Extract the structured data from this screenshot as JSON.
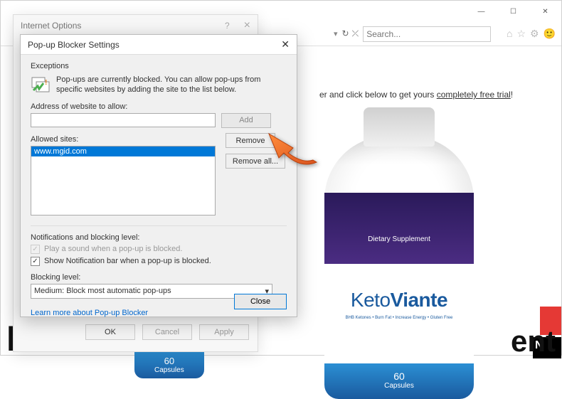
{
  "browser": {
    "search_placeholder": "Search...",
    "url_sep": "▾",
    "refresh": "↻",
    "stop": "⤫"
  },
  "page": {
    "promo_prefix": "er and click below to get yours ",
    "promo_link": "completely free trial",
    "promo_suffix": "!",
    "dietary": "Dietary Supplement",
    "keto": "Keto",
    "viante": "Viante",
    "keto_sub": "BHB Ketones • Burn Fat • Increase Energy • Gluten Free",
    "caps_num": "60",
    "caps_label": "Capsules",
    "black_strip": "N",
    "big_left": "HIS",
    "big_right": "ent"
  },
  "internet_options": {
    "title": "Internet Options",
    "help": "?",
    "close": "×",
    "ok": "OK",
    "cancel": "Cancel",
    "apply": "Apply"
  },
  "popup_blocker": {
    "title": "Pop-up Blocker Settings",
    "close_x": "✕",
    "exceptions_label": "Exceptions",
    "description": "Pop-ups are currently blocked. You can allow pop-ups from specific websites by adding the site to the list below.",
    "address_label": "Address of website to allow:",
    "address_value": "",
    "add_btn": "Add",
    "allowed_label": "Allowed sites:",
    "allowed_sites": [
      "www.mgid.com"
    ],
    "remove_btn": "Remove",
    "remove_all_btn": "Remove all...",
    "notif_heading": "Notifications and blocking level:",
    "play_sound": "Play a sound when a pop-up is blocked.",
    "show_bar": "Show Notification bar when a pop-up is blocked.",
    "blocking_level_label": "Blocking level:",
    "blocking_level_value": "Medium: Block most automatic pop-ups",
    "learn_more": "Learn more about Pop-up Blocker",
    "close_btn": "Close"
  }
}
